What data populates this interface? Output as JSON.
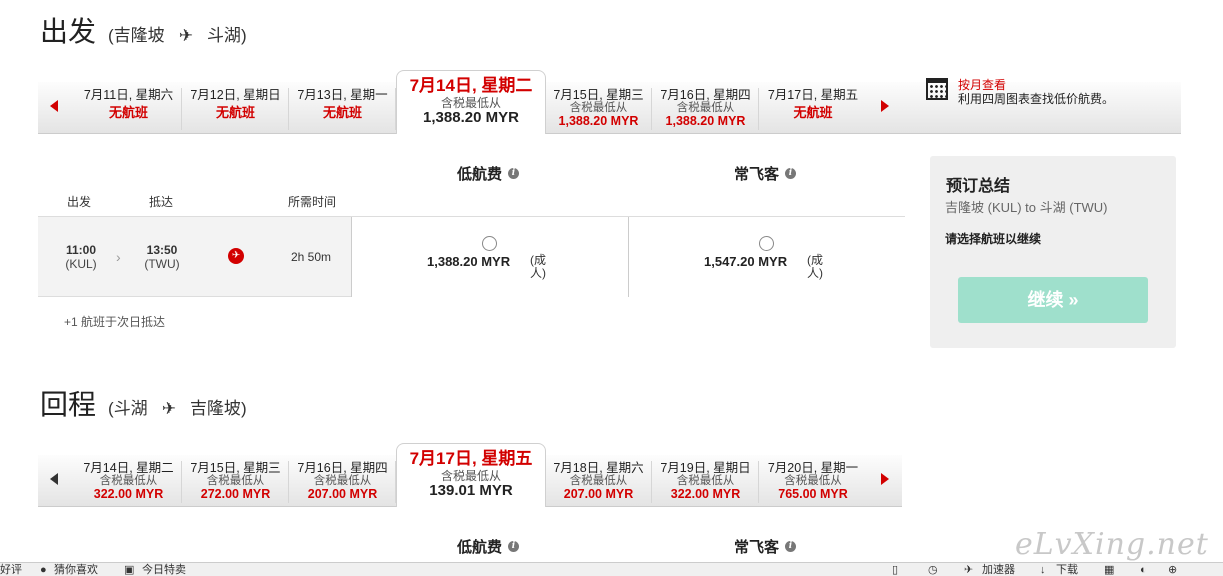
{
  "outbound": {
    "title": "出发",
    "origin": "吉隆坡",
    "destination": "斗湖",
    "plane_glyph": "✈",
    "dates": [
      {
        "date": "7月11日, 星期六",
        "status": "无航班"
      },
      {
        "date": "7月12日, 星期日",
        "status": "无航班"
      },
      {
        "date": "7月13日, 星期一",
        "status": "无航班"
      },
      {
        "date": "7月14日, 星期二",
        "sub": "含税最低从",
        "price": "1,388.20 MYR"
      },
      {
        "date": "7月15日, 星期三",
        "sub": "含税最低从",
        "price": "1,388.20 MYR"
      },
      {
        "date": "7月16日, 星期四",
        "sub": "含税最低从",
        "price": "1,388.20 MYR"
      },
      {
        "date": "7月17日, 星期五",
        "status": "无航班"
      }
    ],
    "calendar_link": {
      "title": "按月查看",
      "desc": "利用四周图表查找低价航费。"
    },
    "fare_headers": {
      "low": "低航费",
      "freq": "常飞客"
    },
    "columns": {
      "depart": "出发",
      "arrive": "抵达",
      "duration": "所需时间"
    },
    "flight": {
      "dep_time": "11:00",
      "dep_code": "(KUL)",
      "arr_time": "13:50",
      "arr_code": "(TWU)",
      "duration": "2h 50m",
      "low_price": "1,388.20 MYR",
      "low_unit": "(成人)",
      "freq_price": "1,547.20 MYR",
      "freq_unit": "(成人)"
    },
    "next_day_note": "+1 航班于次日抵达"
  },
  "return": {
    "title": "回程",
    "origin": "斗湖",
    "destination": "吉隆坡",
    "plane_glyph": "✈",
    "dates": [
      {
        "date": "7月14日, 星期二",
        "sub": "含税最低从",
        "price": "322.00 MYR"
      },
      {
        "date": "7月15日, 星期三",
        "sub": "含税最低从",
        "price": "272.00 MYR"
      },
      {
        "date": "7月16日, 星期四",
        "sub": "含税最低从",
        "price": "207.00 MYR"
      },
      {
        "date": "7月17日, 星期五",
        "sub": "含税最低从",
        "price": "139.01 MYR"
      },
      {
        "date": "7月18日, 星期六",
        "sub": "含税最低从",
        "price": "207.00 MYR"
      },
      {
        "date": "7月19日, 星期日",
        "sub": "含税最低从",
        "price": "322.00 MYR"
      },
      {
        "date": "7月20日, 星期一",
        "sub": "含税最低从",
        "price": "765.00 MYR"
      }
    ],
    "fare_headers": {
      "low": "低航费",
      "freq": "常飞客"
    }
  },
  "summary": {
    "title": "预订总结",
    "route": "吉隆坡 (KUL) to 斗湖 (TWU)",
    "note": "请选择航班以继续",
    "continue": "继续 »"
  },
  "watermark": "eLvXing.net",
  "statusbar": {
    "left": "好评",
    "guess": "猜你喜欢",
    "today": "今日特卖",
    "speed": "加速器",
    "download": "下载"
  },
  "colors": {
    "accent": "#d20000",
    "continue_bg": "#9fe0cc"
  }
}
